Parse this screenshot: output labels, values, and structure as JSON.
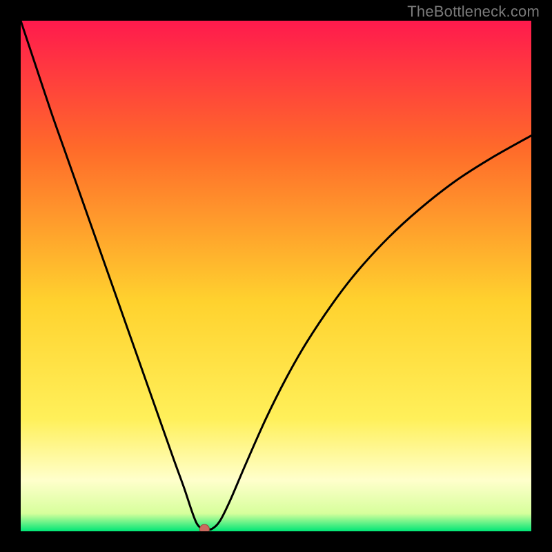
{
  "watermark": "TheBottleneck.com",
  "colors": {
    "frame": "#000000",
    "line": "#000000",
    "marker_fill": "#cc6a5f",
    "marker_stroke": "#9a463c",
    "grad_top": "#ff1a4d",
    "grad_upper": "#ff6a2a",
    "grad_mid": "#ffd22e",
    "grad_lower_yellow": "#fff05a",
    "grad_pale": "#ffffcc",
    "grad_green": "#00e676"
  },
  "chart_data": {
    "type": "line",
    "title": "",
    "xlabel": "",
    "ylabel": "",
    "xlim": [
      0,
      100
    ],
    "ylim": [
      0,
      100
    ],
    "grid": false,
    "legend": false,
    "series": [
      {
        "name": "bottleneck_curve",
        "x": [
          0,
          3,
          6,
          9,
          12,
          15,
          18,
          21,
          24,
          27,
          30,
          32,
          33.5,
          34.5,
          35.5,
          36.5,
          37.5,
          39,
          41,
          44,
          48,
          52,
          56,
          61,
          66,
          72,
          78,
          85,
          92,
          100
        ],
        "y": [
          100,
          91,
          82,
          73.5,
          65,
          56.5,
          48,
          39.5,
          31,
          22.5,
          14,
          8.5,
          4,
          1.5,
          0.5,
          0.4,
          0.5,
          2,
          6,
          13,
          22,
          30,
          37,
          44.5,
          51,
          57.5,
          63,
          68.5,
          73,
          77.5
        ]
      }
    ],
    "marker": {
      "x": 36,
      "y": 0.4
    },
    "background_gradient": {
      "stops": [
        {
          "offset": 0.0,
          "color": "#ff1a4d"
        },
        {
          "offset": 0.25,
          "color": "#ff6a2a"
        },
        {
          "offset": 0.55,
          "color": "#ffd22e"
        },
        {
          "offset": 0.78,
          "color": "#fff05a"
        },
        {
          "offset": 0.9,
          "color": "#ffffcc"
        },
        {
          "offset": 0.965,
          "color": "#d7ff9c"
        },
        {
          "offset": 1.0,
          "color": "#00e676"
        }
      ]
    }
  }
}
